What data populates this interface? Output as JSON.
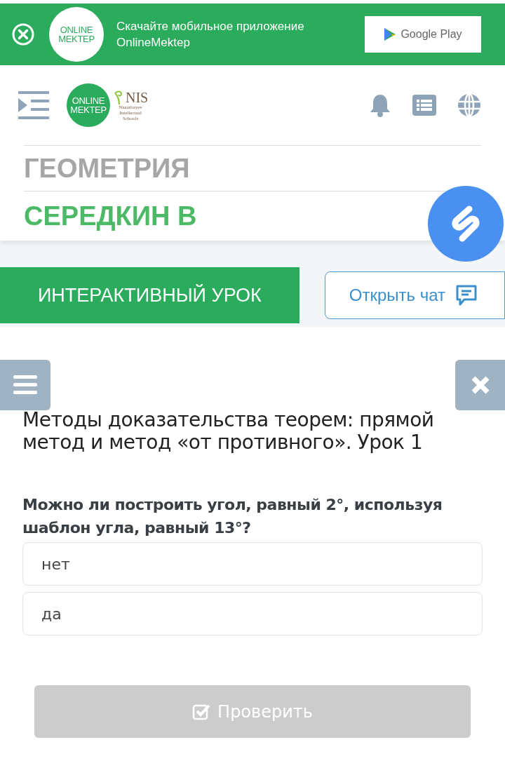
{
  "app_banner": {
    "logo_text": [
      "ONLINE",
      "MEKTEP"
    ],
    "message": [
      "Скачайте мобильное приложение",
      "OnlineMektep"
    ],
    "store_button": "Google Play"
  },
  "header": {
    "logo_text": [
      "ONLINE",
      "MEKTEP"
    ],
    "partner_logo": {
      "name": "NIS",
      "subtitle": [
        "Nazarbayev",
        "Intellectual",
        "Schools"
      ]
    }
  },
  "subject": "ГЕОМЕТРИЯ",
  "teacher": "СЕРЕДКИН В",
  "lesson_tab": "ИНТЕРАКТИВНЫЙ УРОК",
  "chat_button": "Открыть чат",
  "lesson_title": "Методы доказательства теорем: прямой метод и метод «от противного». Урок 1",
  "question": "Можно ли построить угол, равный 2°, используя шаблон угла, равный 13°?",
  "options": [
    {
      "label": "нет",
      "selected": false
    },
    {
      "label": "да",
      "selected": false
    }
  ],
  "check_button": {
    "label": "Проверить",
    "disabled": true
  }
}
